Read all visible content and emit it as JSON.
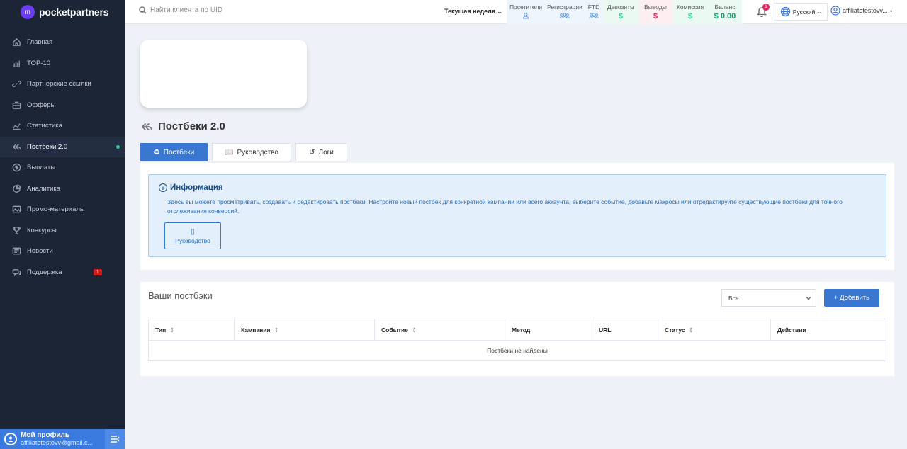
{
  "brand": {
    "name": "pocketpartners"
  },
  "sidebar": {
    "items": [
      {
        "label": "Главная",
        "icon": "home-icon"
      },
      {
        "label": "TOP-10",
        "icon": "bar-chart-icon"
      },
      {
        "label": "Партнерские ссылки",
        "icon": "link-icon"
      },
      {
        "label": "Офферы",
        "icon": "briefcase-icon"
      },
      {
        "label": "Статистика",
        "icon": "line-chart-icon"
      },
      {
        "label": "Постбеки 2.0",
        "icon": "postback-icon",
        "active": true
      },
      {
        "label": "Выплаты",
        "icon": "dollar-circle-icon"
      },
      {
        "label": "Аналитика",
        "icon": "pie-chart-icon"
      },
      {
        "label": "Промо-материалы",
        "icon": "image-icon"
      },
      {
        "label": "Конкурсы",
        "icon": "trophy-icon"
      },
      {
        "label": "Новости",
        "icon": "news-icon"
      },
      {
        "label": "Поддержка",
        "icon": "support-icon",
        "badge": "1"
      }
    ],
    "profile": {
      "title": "Мой профиль",
      "email": "affiliatetestovv@gmail.c..."
    }
  },
  "header": {
    "search_placeholder": "Найти клиента по UID",
    "period": "Текущая неделя",
    "stats": [
      {
        "label": "Посетители",
        "value": "",
        "icon": "user-icon",
        "color": "#5aa0e6",
        "bg": "#eef5fd"
      },
      {
        "label": "Регистрации",
        "value": "",
        "icon": "users-icon",
        "color": "#5aa0e6",
        "bg": "#eef5fd"
      },
      {
        "label": "FTD",
        "value": "",
        "icon": "users-icon",
        "color": "#5aa0e6",
        "bg": "#eef5fd"
      },
      {
        "label": "Депозиты",
        "value": "$",
        "color": "#2fcf92",
        "bg": "#eafaf3"
      },
      {
        "label": "Выводы",
        "value": "$",
        "color": "#e0245e",
        "bg": "#fdeef2"
      },
      {
        "label": "Комиссия",
        "value": "$",
        "color": "#2fcf92",
        "bg": "#eafaf3"
      },
      {
        "label": "Баланс",
        "value": "$ 0.00",
        "color": "#169c6b",
        "bg": "#eafaf3"
      }
    ],
    "notifications": "1",
    "language": "Русский",
    "username": "affiliatetestovv..."
  },
  "page": {
    "title": "Постбеки 2.0",
    "tabs": [
      {
        "label": "Постбеки",
        "glyph": "♻",
        "active": true
      },
      {
        "label": "Руководство",
        "glyph": "📖"
      },
      {
        "label": "Логи",
        "glyph": "↺"
      }
    ],
    "info": {
      "title": "Информация",
      "text": "Здесь вы можете просматривать, создавать и редактировать постбеки. Настройте новый постбек для конкретной кампании или всего аккаунта, выберите событие, добавьте макросы или отредактируйте существующие постбеки для точного отслеживания конверсий.",
      "button": "Руководство"
    },
    "list": {
      "title": "Ваши постбэки",
      "filter": "Все",
      "add_button": "+ Добавить",
      "columns": [
        "Тип",
        "Кампания",
        "Событие",
        "Метод",
        "URL",
        "Статус",
        "Действия"
      ],
      "sortable": [
        true,
        true,
        true,
        false,
        false,
        true,
        false
      ],
      "empty": "Постбеки не найдены"
    }
  }
}
